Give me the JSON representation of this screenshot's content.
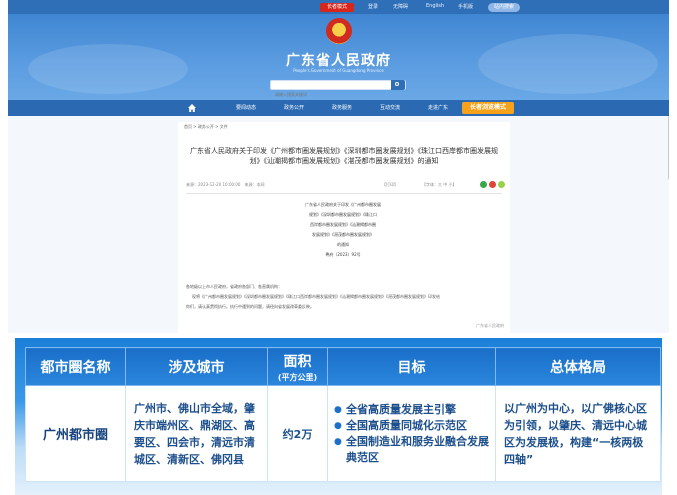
{
  "top_bar": {
    "elder_mode": "长者模式",
    "links": [
      "登录",
      "无障碍",
      "English",
      "手机版"
    ],
    "search": "站内搜索"
  },
  "banner": {
    "title": "广东省人民政府",
    "subtitle": "People's Government of Guangdong Province",
    "search_placeholder": "请输入搜索关键词"
  },
  "nav": {
    "items": [
      "要闻动态",
      "政务公开",
      "政务服务",
      "互动交流",
      "走进广东"
    ],
    "highlight": "长者浏览模式"
  },
  "article": {
    "breadcrumb": "首页 > 政务公开 > 文件",
    "title": "广东省人民政府关于印发《广州都市圈发展规划》《深圳都市圈发展规划》《珠江口西岸都市圈发展规划》《汕潮揭都市圈发展规划》《湛茂都市圈发展规划》的通知",
    "source": "来源：2023-12-20 10:00:00　来源：本网",
    "font_controls": "【打印】",
    "size_label": "【字体：大 中 小】",
    "doc_head_lines": [
      "广东省人民政府关于印发《广州都市圈发展",
      "规划》《深圳都市圈发展规划》《珠江口",
      "西岸都市圈发展规划》《汕潮揭都市圈",
      "发展规划》《湛茂都市圈发展规划》",
      "的通知",
      "粤府〔2023〕92号"
    ],
    "body_lines": [
      "各地级以上市人民政府，省政府各部门、各直属机构：",
      "现将《广州都市圈发展规划》《深圳都市圈发展规划》《珠江口西岸都市圈发展规划》《汕潮揭都市圈发展规划》《湛茂都市圈发展规划》印发给",
      "你们，请认真贯彻执行。执行中遇到的问题，请径向省发展改革委反映。"
    ],
    "end_mark": "广东省人民政府"
  },
  "table": {
    "headers": [
      {
        "label": "都市圈名称"
      },
      {
        "label": "涉及城市"
      },
      {
        "label": "面积",
        "sub": "(平方公里)"
      },
      {
        "label": "目标"
      },
      {
        "label": "总体格局"
      }
    ],
    "rows": [
      {
        "name": "广州都市圈",
        "cities": "广州市、佛山市全域，肇庆市端州区、鼎湖区、高要区、四会市，清远市清城区、清新区、佛冈县",
        "area": "约2万",
        "goals": [
          "全省高质量发展主引擎",
          "全国高质量同城化示范区",
          "全国制造业和服务业融合发展典范区"
        ],
        "pattern": "以广州为中心，以广佛核心区为引领，以肇庆、清远中心城区为发展极，构建“一核两极四轴”"
      }
    ]
  },
  "colors": {
    "nav_blue": "#2b6ab3",
    "accent_orange": "#f7a21b",
    "header_blue": "#1a6fc9",
    "elder_red": "#d8261c"
  }
}
